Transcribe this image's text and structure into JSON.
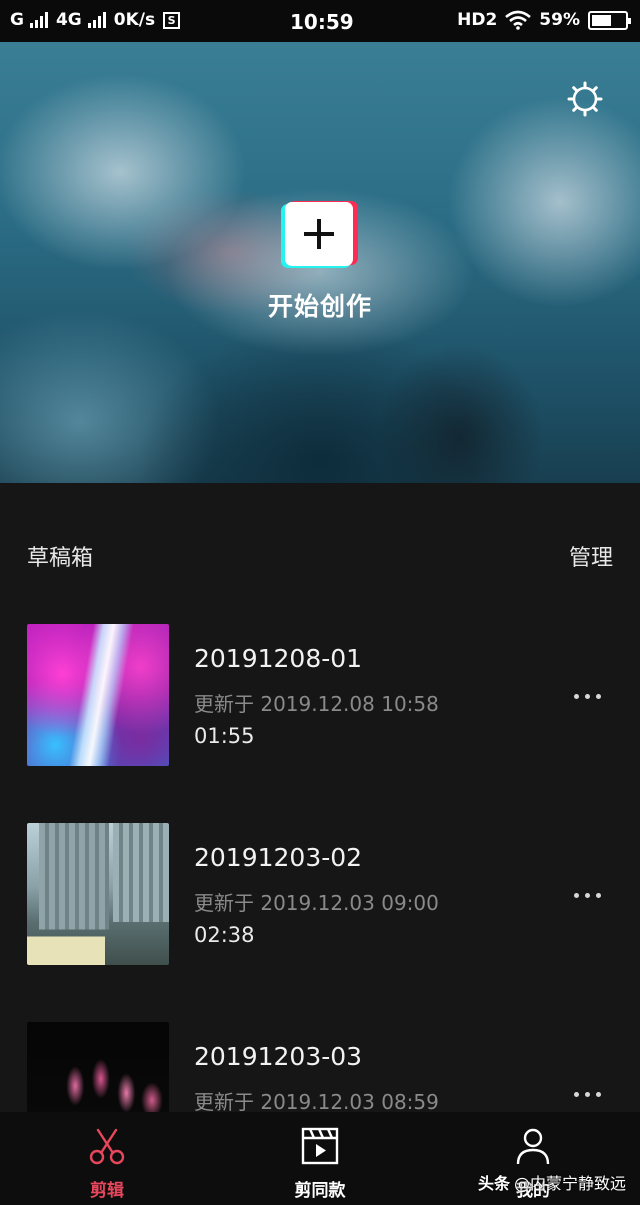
{
  "status_bar": {
    "carrier1": "G",
    "carrier2": "4G",
    "speed": "0K/s",
    "sim_badge": "S",
    "time": "10:59",
    "hd": "HD2",
    "battery_text": "59%",
    "battery_level": 0.59
  },
  "hero": {
    "settings_icon": "gear-icon",
    "create_icon": "plus-icon",
    "create_label": "开始创作"
  },
  "drafts": {
    "title": "草稿箱",
    "manage_label": "管理",
    "items": [
      {
        "name": "20191208-01",
        "updated": "更新于 2019.12.08 10:58",
        "duration": "01:55"
      },
      {
        "name": "20191203-02",
        "updated": "更新于 2019.12.03 09:00",
        "duration": "02:38"
      },
      {
        "name": "20191203-03",
        "updated": "更新于 2019.12.03 08:59",
        "duration": ""
      }
    ]
  },
  "bottom_nav": {
    "items": [
      {
        "label": "剪辑",
        "icon": "scissors-icon",
        "active": true
      },
      {
        "label": "剪同款",
        "icon": "clapperboard-icon",
        "active": false
      },
      {
        "label": "我的",
        "icon": "person-icon",
        "active": false
      }
    ]
  },
  "watermark": {
    "brand": "头条",
    "handle": "@内蒙宁静致远"
  },
  "colors": {
    "accent": "#e8465c",
    "background": "#161616",
    "secondary_text": "#8a8a8a"
  }
}
